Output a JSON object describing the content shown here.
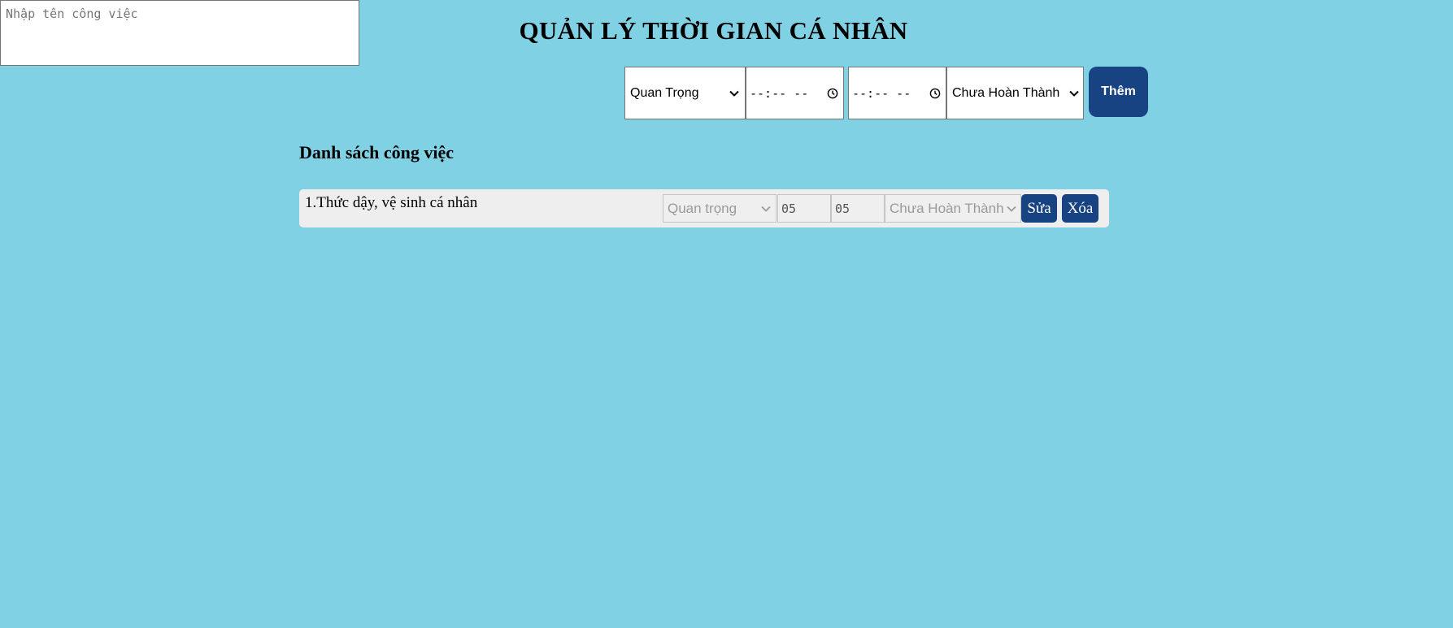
{
  "header": {
    "title": "QUẢN LÝ THỜI GIAN CÁ NHÂN"
  },
  "form": {
    "task_placeholder": "Nhập tên công việc",
    "priority_selected": "Quan Trọng",
    "start_time_placeholder": "--:-- --",
    "end_time_placeholder": "--:-- --",
    "status_selected": "Chưa Hoàn Thành",
    "add_label": "Thêm"
  },
  "list": {
    "title": "Danh sách công việc",
    "items": [
      {
        "text": "1.Thức dậy, vệ sinh cá nhân",
        "priority": "Quan trọng",
        "start": "05",
        "end": "05",
        "status": "Chưa Hoàn Thành",
        "edit_label": "Sửa",
        "delete_label": "Xóa"
      }
    ]
  },
  "colors": {
    "background": "#81d1e5",
    "button": "#184382"
  },
  "icons": {
    "dropdown": "chevron-down-icon",
    "time": "clock-icon"
  }
}
